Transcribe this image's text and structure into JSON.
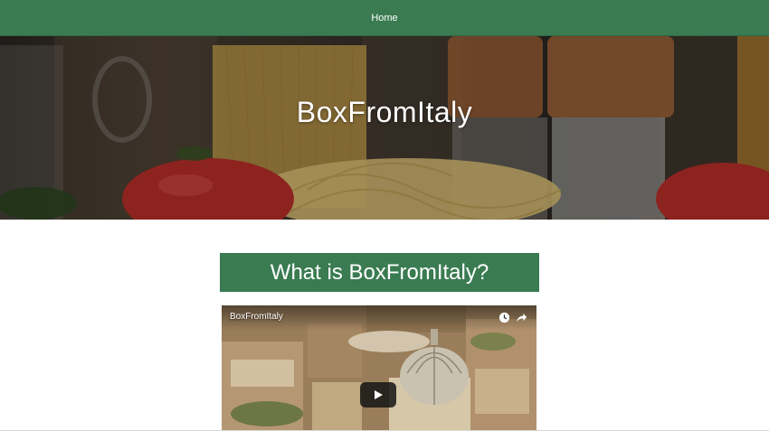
{
  "nav": {
    "home_label": "Home"
  },
  "hero": {
    "title": "BoxFromItaly"
  },
  "section": {
    "title": "What is BoxFromItaly?"
  },
  "video": {
    "title": "BoxFromItaly"
  },
  "colors": {
    "brand_green": "#3a7b52",
    "white": "#ffffff"
  },
  "icons": {
    "watch_later": "clock-icon",
    "share": "share-icon",
    "play": "play-icon"
  }
}
